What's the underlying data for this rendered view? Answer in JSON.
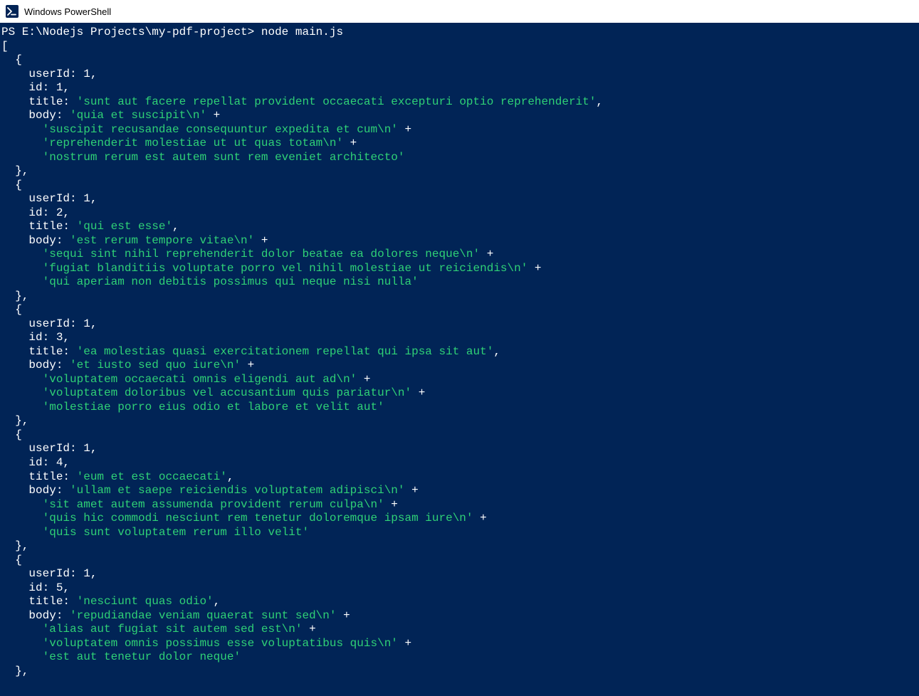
{
  "window": {
    "title": "Windows PowerShell"
  },
  "prompt": {
    "prefix": "PS E:\\Nodejs Projects\\my-pdf-project>",
    "command": "node",
    "arg": "main.js"
  },
  "output": {
    "items": [
      {
        "userId": 1,
        "id": 1,
        "title": "'sunt aut facere repellat provident occaecati excepturi optio reprehenderit'",
        "body": [
          "'quia et suscipit\\n'",
          "'suscipit recusandae consequuntur expedita et cum\\n'",
          "'reprehenderit molestiae ut ut quas totam\\n'",
          "'nostrum rerum est autem sunt rem eveniet architecto'"
        ]
      },
      {
        "userId": 1,
        "id": 2,
        "title": "'qui est esse'",
        "body": [
          "'est rerum tempore vitae\\n'",
          "'sequi sint nihil reprehenderit dolor beatae ea dolores neque\\n'",
          "'fugiat blanditiis voluptate porro vel nihil molestiae ut reiciendis\\n'",
          "'qui aperiam non debitis possimus qui neque nisi nulla'"
        ]
      },
      {
        "userId": 1,
        "id": 3,
        "title": "'ea molestias quasi exercitationem repellat qui ipsa sit aut'",
        "body": [
          "'et iusto sed quo iure\\n'",
          "'voluptatem occaecati omnis eligendi aut ad\\n'",
          "'voluptatem doloribus vel accusantium quis pariatur\\n'",
          "'molestiae porro eius odio et labore et velit aut'"
        ]
      },
      {
        "userId": 1,
        "id": 4,
        "title": "'eum et est occaecati'",
        "body": [
          "'ullam et saepe reiciendis voluptatem adipisci\\n'",
          "'sit amet autem assumenda provident rerum culpa\\n'",
          "'quis hic commodi nesciunt rem tenetur doloremque ipsam iure\\n'",
          "'quis sunt voluptatem rerum illo velit'"
        ]
      },
      {
        "userId": 1,
        "id": 5,
        "title": "'nesciunt quas odio'",
        "body": [
          "'repudiandae veniam quaerat sunt sed\\n'",
          "'alias aut fugiat sit autem sed est\\n'",
          "'voluptatem omnis possimus esse voluptatibus quis\\n'",
          "'est aut tenetur dolor neque'"
        ]
      }
    ]
  }
}
